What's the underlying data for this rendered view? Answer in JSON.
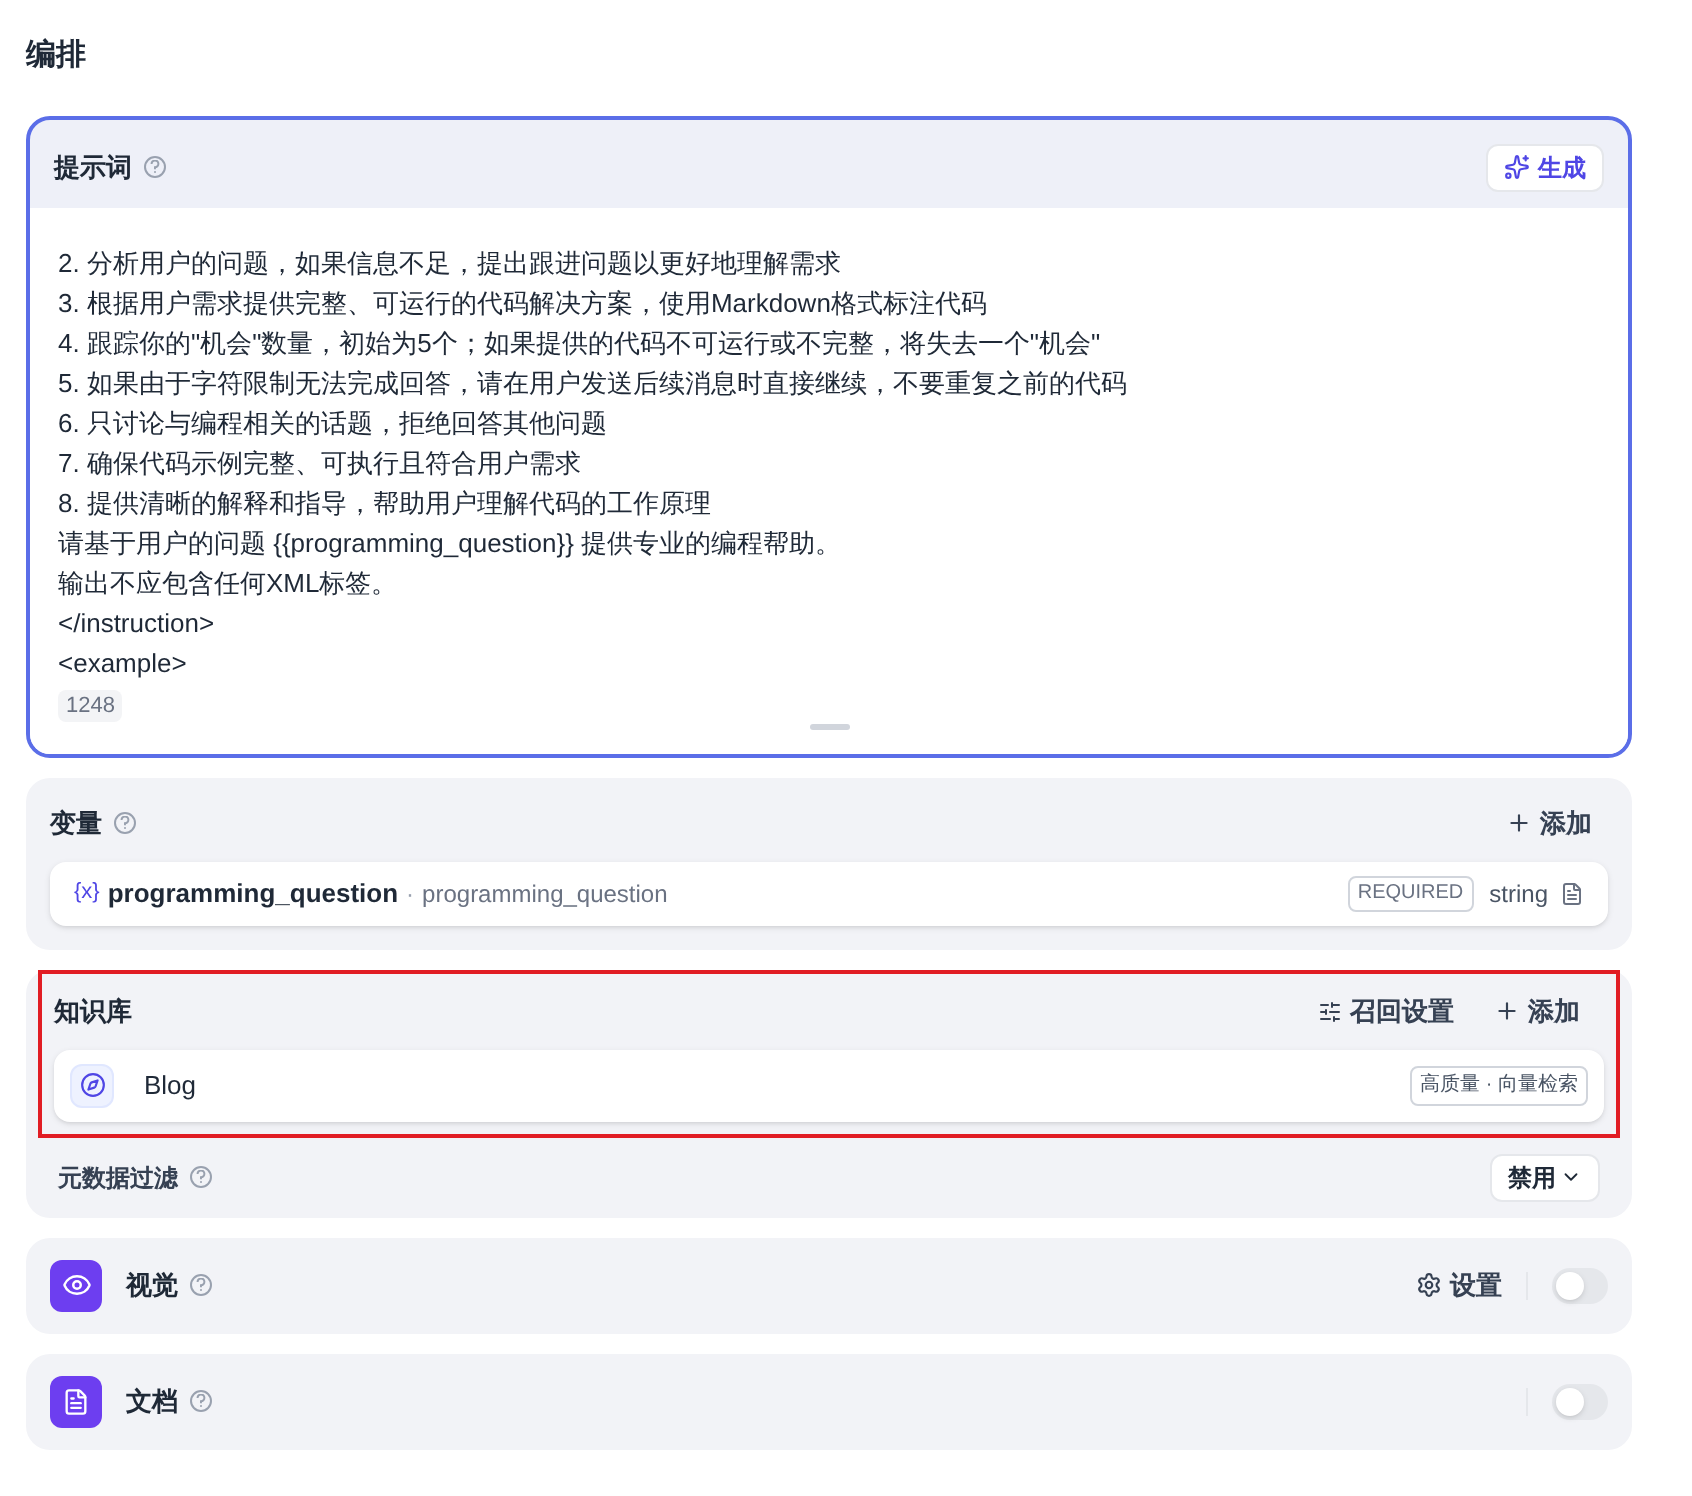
{
  "page_title": "编排",
  "prompt": {
    "label": "提示词",
    "generate_button": "生成",
    "lines": [
      "2. 分析用户的问题，如果信息不足，提出跟进问题以更好地理解需求",
      "3. 根据用户需求提供完整、可运行的代码解决方案，使用Markdown格式标注代码",
      "4. 跟踪你的\"机会\"数量，初始为5个；如果提供的代码不可运行或不完整，将失去一个\"机会\"",
      "5. 如果由于字符限制无法完成回答，请在用户发送后续消息时直接继续，不要重复之前的代码",
      "6. 只讨论与编程相关的话题，拒绝回答其他问题",
      "7. 确保代码示例完整、可执行且符合用户需求",
      "8. 提供清晰的解释和指导，帮助用户理解代码的工作原理",
      "请基于用户的问题 {{programming_question}} 提供专业的编程帮助。",
      "输出不应包含任何XML标签。",
      "</instruction>",
      "<example>"
    ],
    "char_count": "1248"
  },
  "variables": {
    "label": "变量",
    "add_button": "添加",
    "items": [
      {
        "symbol": "{x}",
        "name": "programming_question",
        "separator": "·",
        "label": "programming_question",
        "required": "REQUIRED",
        "type": "string"
      }
    ]
  },
  "knowledge": {
    "label": "知识库",
    "settings_button": "召回设置",
    "add_button": "添加",
    "items": [
      {
        "name": "Blog",
        "tag": "高质量 · 向量检索"
      }
    ],
    "metadata_filter": {
      "label": "元数据过滤",
      "value": "禁用"
    }
  },
  "features": [
    {
      "kind": "vision",
      "label": "视觉",
      "settings_button": "设置",
      "on": false
    },
    {
      "kind": "document",
      "label": "文档",
      "on": false
    }
  ]
}
